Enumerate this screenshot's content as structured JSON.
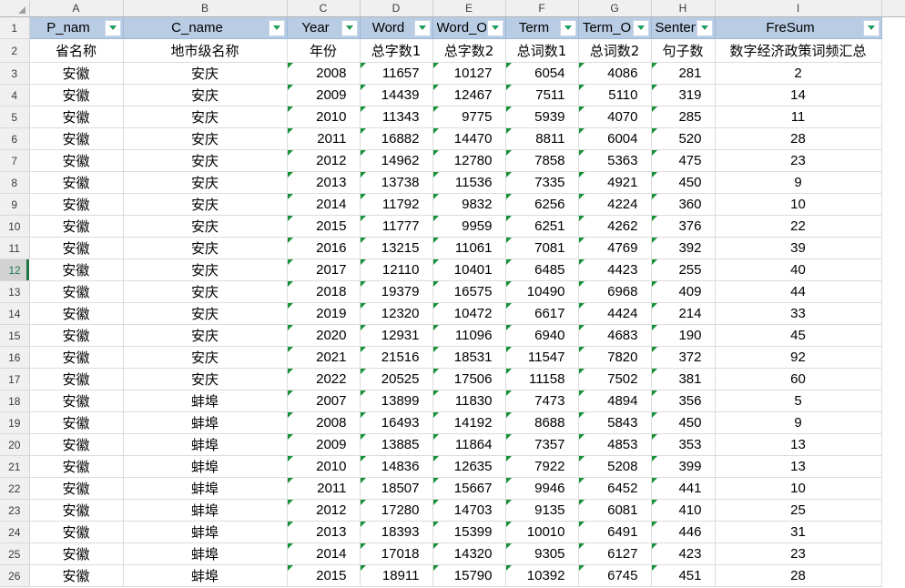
{
  "spreadsheet": {
    "select_all_corner": "select-all-triangle",
    "column_letters": [
      "A",
      "B",
      "C",
      "D",
      "E",
      "F",
      "G",
      "H",
      "I"
    ],
    "row_numbers": [
      "1",
      "2",
      "3",
      "4",
      "5",
      "6",
      "7",
      "8",
      "9",
      "10",
      "11",
      "12",
      "13",
      "14",
      "15",
      "16",
      "17",
      "18",
      "19",
      "20",
      "21",
      "22",
      "23",
      "24",
      "25",
      "26"
    ],
    "active_row": "12",
    "accent_color": "#217346",
    "header_fill": "#b8cce4",
    "filter_marker_color": "#1f9d5a",
    "text_flag_color": "#169138",
    "filter_headers": [
      {
        "label": "P_nam",
        "has_filter": true
      },
      {
        "label": "C_name",
        "has_filter": true
      },
      {
        "label": "Year",
        "has_filter": true
      },
      {
        "label": "Word",
        "has_filter": true
      },
      {
        "label": "Word_O",
        "has_filter": true
      },
      {
        "label": "Term",
        "has_filter": true
      },
      {
        "label": "Term_O",
        "has_filter": true
      },
      {
        "label": "Senten",
        "has_filter": true
      },
      {
        "label": "FreSum",
        "has_filter": true
      }
    ],
    "description_row": [
      "省名称",
      "地市级名称",
      "年份",
      "总字数1",
      "总字数2",
      "总词数1",
      "总词数2",
      "句子数",
      "数字经济政策词频汇总"
    ],
    "rows": [
      {
        "row": "3",
        "P_name": "安徽",
        "C_name": "安庆",
        "Year": "2008",
        "Word": "11657",
        "Word_O": "10127",
        "Term": "6054",
        "Term_O": "4086",
        "Senten": "281",
        "FreSum": "2"
      },
      {
        "row": "4",
        "P_name": "安徽",
        "C_name": "安庆",
        "Year": "2009",
        "Word": "14439",
        "Word_O": "12467",
        "Term": "7511",
        "Term_O": "5110",
        "Senten": "319",
        "FreSum": "14"
      },
      {
        "row": "5",
        "P_name": "安徽",
        "C_name": "安庆",
        "Year": "2010",
        "Word": "11343",
        "Word_O": "9775",
        "Term": "5939",
        "Term_O": "4070",
        "Senten": "285",
        "FreSum": "11"
      },
      {
        "row": "6",
        "P_name": "安徽",
        "C_name": "安庆",
        "Year": "2011",
        "Word": "16882",
        "Word_O": "14470",
        "Term": "8811",
        "Term_O": "6004",
        "Senten": "520",
        "FreSum": "28"
      },
      {
        "row": "7",
        "P_name": "安徽",
        "C_name": "安庆",
        "Year": "2012",
        "Word": "14962",
        "Word_O": "12780",
        "Term": "7858",
        "Term_O": "5363",
        "Senten": "475",
        "FreSum": "23"
      },
      {
        "row": "8",
        "P_name": "安徽",
        "C_name": "安庆",
        "Year": "2013",
        "Word": "13738",
        "Word_O": "11536",
        "Term": "7335",
        "Term_O": "4921",
        "Senten": "450",
        "FreSum": "9"
      },
      {
        "row": "9",
        "P_name": "安徽",
        "C_name": "安庆",
        "Year": "2014",
        "Word": "11792",
        "Word_O": "9832",
        "Term": "6256",
        "Term_O": "4224",
        "Senten": "360",
        "FreSum": "10"
      },
      {
        "row": "10",
        "P_name": "安徽",
        "C_name": "安庆",
        "Year": "2015",
        "Word": "11777",
        "Word_O": "9959",
        "Term": "6251",
        "Term_O": "4262",
        "Senten": "376",
        "FreSum": "22"
      },
      {
        "row": "11",
        "P_name": "安徽",
        "C_name": "安庆",
        "Year": "2016",
        "Word": "13215",
        "Word_O": "11061",
        "Term": "7081",
        "Term_O": "4769",
        "Senten": "392",
        "FreSum": "39"
      },
      {
        "row": "12",
        "P_name": "安徽",
        "C_name": "安庆",
        "Year": "2017",
        "Word": "12110",
        "Word_O": "10401",
        "Term": "6485",
        "Term_O": "4423",
        "Senten": "255",
        "FreSum": "40"
      },
      {
        "row": "13",
        "P_name": "安徽",
        "C_name": "安庆",
        "Year": "2018",
        "Word": "19379",
        "Word_O": "16575",
        "Term": "10490",
        "Term_O": "6968",
        "Senten": "409",
        "FreSum": "44"
      },
      {
        "row": "14",
        "P_name": "安徽",
        "C_name": "安庆",
        "Year": "2019",
        "Word": "12320",
        "Word_O": "10472",
        "Term": "6617",
        "Term_O": "4424",
        "Senten": "214",
        "FreSum": "33"
      },
      {
        "row": "15",
        "P_name": "安徽",
        "C_name": "安庆",
        "Year": "2020",
        "Word": "12931",
        "Word_O": "11096",
        "Term": "6940",
        "Term_O": "4683",
        "Senten": "190",
        "FreSum": "45"
      },
      {
        "row": "16",
        "P_name": "安徽",
        "C_name": "安庆",
        "Year": "2021",
        "Word": "21516",
        "Word_O": "18531",
        "Term": "11547",
        "Term_O": "7820",
        "Senten": "372",
        "FreSum": "92"
      },
      {
        "row": "17",
        "P_name": "安徽",
        "C_name": "安庆",
        "Year": "2022",
        "Word": "20525",
        "Word_O": "17506",
        "Term": "11158",
        "Term_O": "7502",
        "Senten": "381",
        "FreSum": "60"
      },
      {
        "row": "18",
        "P_name": "安徽",
        "C_name": "蚌埠",
        "Year": "2007",
        "Word": "13899",
        "Word_O": "11830",
        "Term": "7473",
        "Term_O": "4894",
        "Senten": "356",
        "FreSum": "5"
      },
      {
        "row": "19",
        "P_name": "安徽",
        "C_name": "蚌埠",
        "Year": "2008",
        "Word": "16493",
        "Word_O": "14192",
        "Term": "8688",
        "Term_O": "5843",
        "Senten": "450",
        "FreSum": "9"
      },
      {
        "row": "20",
        "P_name": "安徽",
        "C_name": "蚌埠",
        "Year": "2009",
        "Word": "13885",
        "Word_O": "11864",
        "Term": "7357",
        "Term_O": "4853",
        "Senten": "353",
        "FreSum": "13"
      },
      {
        "row": "21",
        "P_name": "安徽",
        "C_name": "蚌埠",
        "Year": "2010",
        "Word": "14836",
        "Word_O": "12635",
        "Term": "7922",
        "Term_O": "5208",
        "Senten": "399",
        "FreSum": "13"
      },
      {
        "row": "22",
        "P_name": "安徽",
        "C_name": "蚌埠",
        "Year": "2011",
        "Word": "18507",
        "Word_O": "15667",
        "Term": "9946",
        "Term_O": "6452",
        "Senten": "441",
        "FreSum": "10"
      },
      {
        "row": "23",
        "P_name": "安徽",
        "C_name": "蚌埠",
        "Year": "2012",
        "Word": "17280",
        "Word_O": "14703",
        "Term": "9135",
        "Term_O": "6081",
        "Senten": "410",
        "FreSum": "25"
      },
      {
        "row": "24",
        "P_name": "安徽",
        "C_name": "蚌埠",
        "Year": "2013",
        "Word": "18393",
        "Word_O": "15399",
        "Term": "10010",
        "Term_O": "6491",
        "Senten": "446",
        "FreSum": "31"
      },
      {
        "row": "25",
        "P_name": "安徽",
        "C_name": "蚌埠",
        "Year": "2014",
        "Word": "17018",
        "Word_O": "14320",
        "Term": "9305",
        "Term_O": "6127",
        "Senten": "423",
        "FreSum": "23"
      },
      {
        "row": "26",
        "P_name": "安徽",
        "C_name": "蚌埠",
        "Year": "2015",
        "Word": "18911",
        "Word_O": "15790",
        "Term": "10392",
        "Term_O": "6745",
        "Senten": "451",
        "FreSum": "28"
      }
    ]
  }
}
